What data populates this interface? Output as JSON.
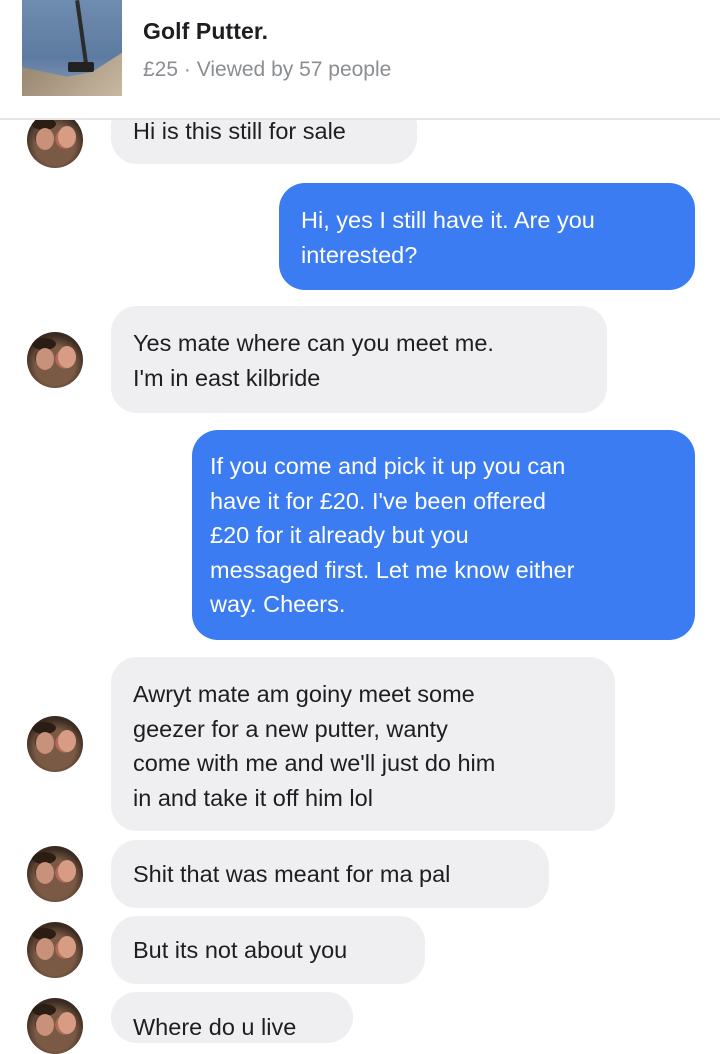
{
  "listing": {
    "title": "Golf Putter.",
    "price": "£25",
    "separator": "·",
    "views": "Viewed by 57 people"
  },
  "messages": [
    {
      "id": "m1",
      "direction": "incoming",
      "text": "Hi is this still for sale"
    },
    {
      "id": "m2",
      "direction": "outgoing",
      "text": "Hi, yes I still have it. Are you\ninterested?"
    },
    {
      "id": "m3",
      "direction": "incoming",
      "text": "Yes mate where can you meet me.\nI'm in east kilbride"
    },
    {
      "id": "m4",
      "direction": "outgoing",
      "text": "If you come and pick it up you can\nhave it for £20. I've been offered\n£20 for it already but you\nmessaged first. Let me know either\nway. Cheers."
    },
    {
      "id": "m5",
      "direction": "incoming",
      "text": "Awryt mate am goiny meet some\ngeezer for a new putter, wanty\ncome with me and we'll just do him\nin and take it off him lol"
    },
    {
      "id": "m6",
      "direction": "incoming",
      "text": "Shit that was meant for ma pal"
    },
    {
      "id": "m7",
      "direction": "incoming",
      "text": "But its not about you"
    },
    {
      "id": "m8",
      "direction": "incoming",
      "text": "Where do u live"
    }
  ]
}
